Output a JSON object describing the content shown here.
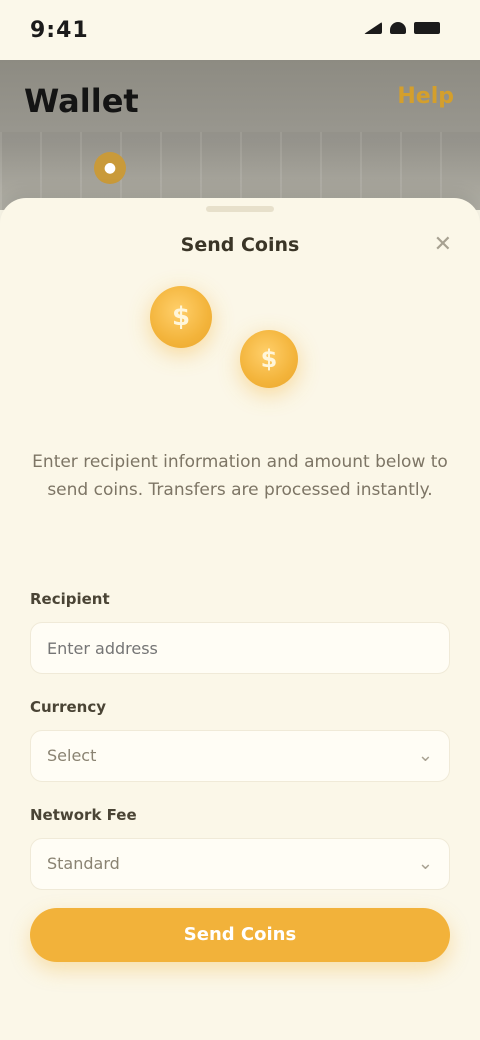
{
  "status_bar": {
    "time": "9:41"
  },
  "header": {
    "title": "Wallet",
    "action_label": "Help",
    "tab_icon": "coin-icon"
  },
  "sheet": {
    "title": "Send Coins",
    "close_icon": "close-icon",
    "coin_symbol": "$",
    "description": "Enter recipient information and amount below to send coins. Transfers are processed instantly.",
    "fields": [
      {
        "label": "Recipient",
        "value": "Enter address",
        "type": "input"
      },
      {
        "label": "Currency",
        "value": "Select",
        "type": "select"
      },
      {
        "label": "Network Fee",
        "value": "Standard",
        "type": "select"
      }
    ],
    "confirm_label": "Send Coins"
  },
  "colors": {
    "accent": "#f2b23a",
    "background": "#fbf7e8",
    "header_bg": "#9a9890"
  }
}
